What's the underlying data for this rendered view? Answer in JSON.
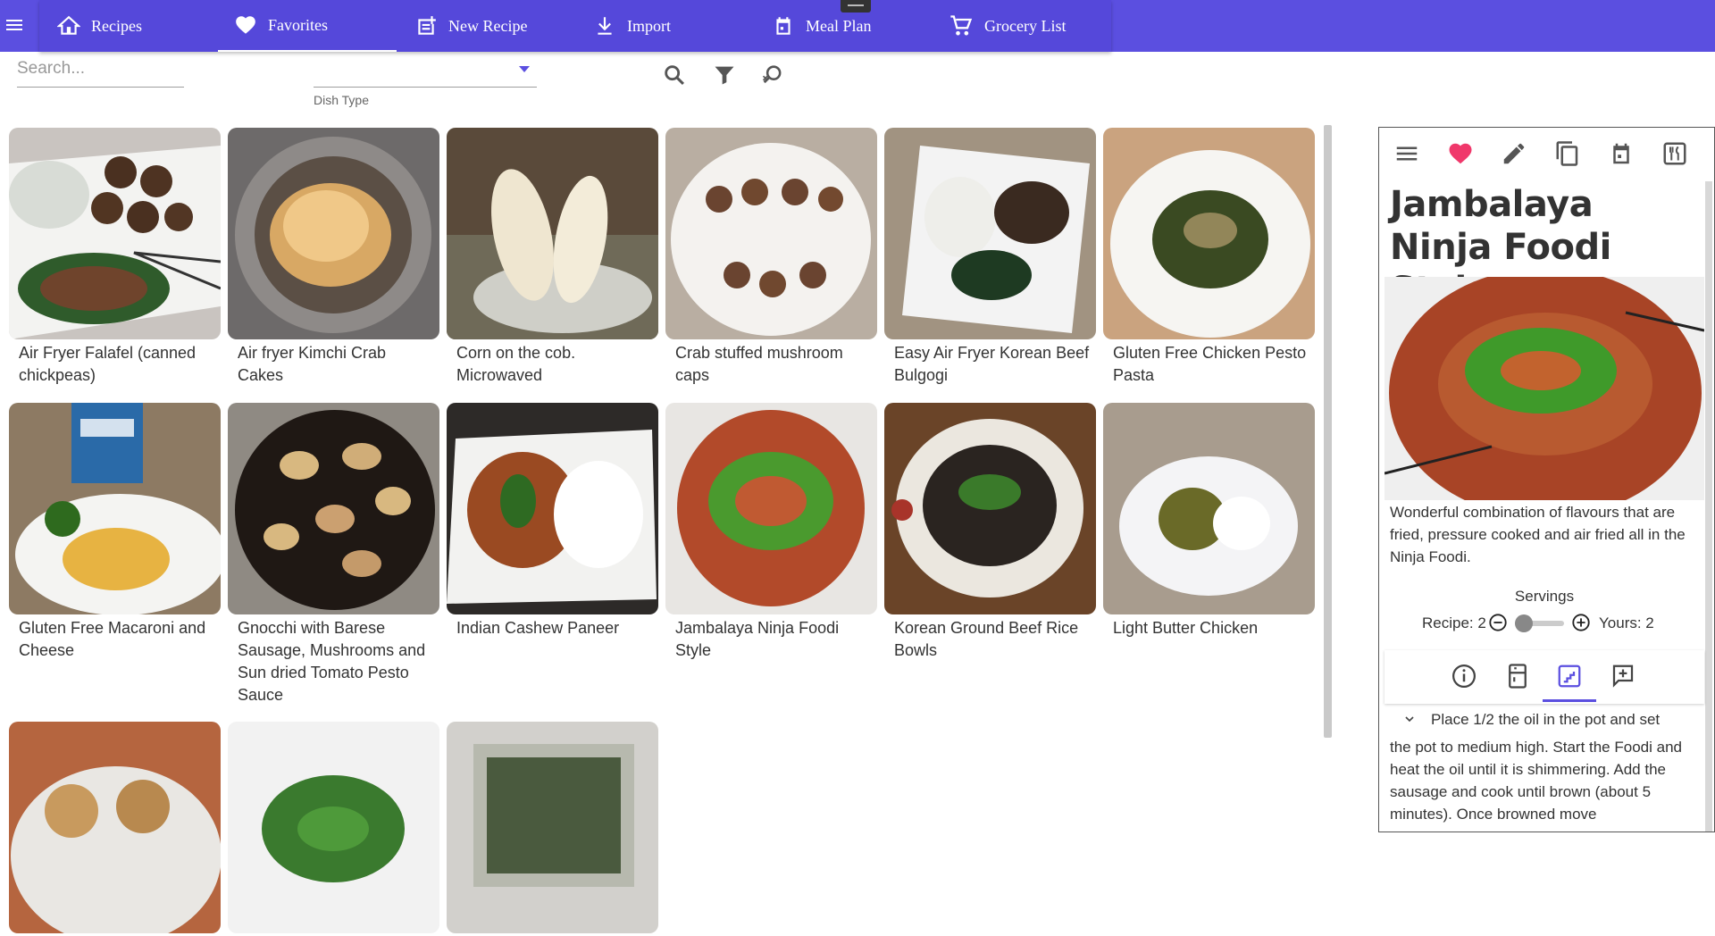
{
  "nav": {
    "items": [
      {
        "label": "Recipes",
        "icon": "home-icon"
      },
      {
        "label": "Favorites",
        "icon": "heart-icon"
      },
      {
        "label": "New Recipe",
        "icon": "new-recipe-icon"
      },
      {
        "label": "Import",
        "icon": "download-icon"
      },
      {
        "label": "Meal Plan",
        "icon": "calendar-icon"
      },
      {
        "label": "Grocery List",
        "icon": "cart-icon"
      }
    ],
    "active": "Favorites"
  },
  "filters": {
    "search_placeholder": "Search...",
    "dish_type_label": "Dish Type"
  },
  "recipes": [
    {
      "name": "Air Fryer Falafel (canned chickpeas)"
    },
    {
      "name": "Air fryer Kimchi Crab Cakes"
    },
    {
      "name": "Corn on the cob. Microwaved"
    },
    {
      "name": "Crab stuffed mushroom caps"
    },
    {
      "name": "Easy Air Fryer Korean Beef Bulgogi"
    },
    {
      "name": "Gluten Free Chicken Pesto Pasta"
    },
    {
      "name": "Gluten Free Macaroni and Cheese"
    },
    {
      "name": "Gnocchi with Barese Sausage, Mushrooms and Sun dried Tomato Pesto Sauce"
    },
    {
      "name": "Indian Cashew Paneer"
    },
    {
      "name": "Jambalaya Ninja Foodi Style"
    },
    {
      "name": "Korean Ground Beef Rice Bowls"
    },
    {
      "name": "Light Butter Chicken"
    },
    {
      "name": ""
    },
    {
      "name": ""
    },
    {
      "name": ""
    }
  ],
  "detail": {
    "title": "Jambalaya Ninja Foodi Style",
    "description": "Wonderful combination of flavours that are fried, pressure cooked and air fried all in the Ninja Foodi.",
    "servings_label": "Servings",
    "recipe_servings": "Recipe: 2",
    "your_servings": "Yours: 2",
    "step_heading": "Place 1/2 the oil in the pot and set",
    "step_body": "the pot to medium high. Start the Foodi and heat the oil until it is shimmering. Add the sausage and cook until brown (about 5 minutes). Once browned move"
  },
  "colors": {
    "primary": "#5b4fe0",
    "favorite": "#f0386b"
  }
}
